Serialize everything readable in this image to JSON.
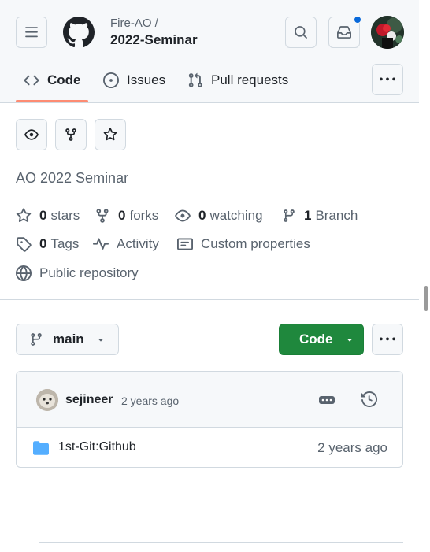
{
  "header": {
    "owner": "Fire-AO /",
    "repo": "2022-Seminar"
  },
  "tabs": [
    {
      "label": "Code",
      "selected": true
    },
    {
      "label": "Issues"
    },
    {
      "label": "Pull requests"
    }
  ],
  "repo_info": {
    "description": "AO 2022 Seminar",
    "stars_count": "0",
    "stars_label": "stars",
    "forks_count": "0",
    "forks_label": "forks",
    "watching_count": "0",
    "watching_label": "watching",
    "branch_count": "1",
    "branch_label": "Branch",
    "tags_count": "0",
    "tags_label": "Tags",
    "activity_label": "Activity",
    "custom_properties_label": "Custom properties",
    "visibility_label": "Public repository"
  },
  "toolbar": {
    "branch_name": "main",
    "code_label": "Code"
  },
  "commit": {
    "user": "sejineer",
    "time": "2 years ago"
  },
  "files": [
    {
      "name": "1st-Git:Github",
      "time": "2 years ago",
      "type": "folder"
    }
  ],
  "colors": {
    "accent": "#0969da",
    "primary_button": "#1f883d",
    "tab_underline": "#fd8c73",
    "folder": "#54aeff"
  }
}
